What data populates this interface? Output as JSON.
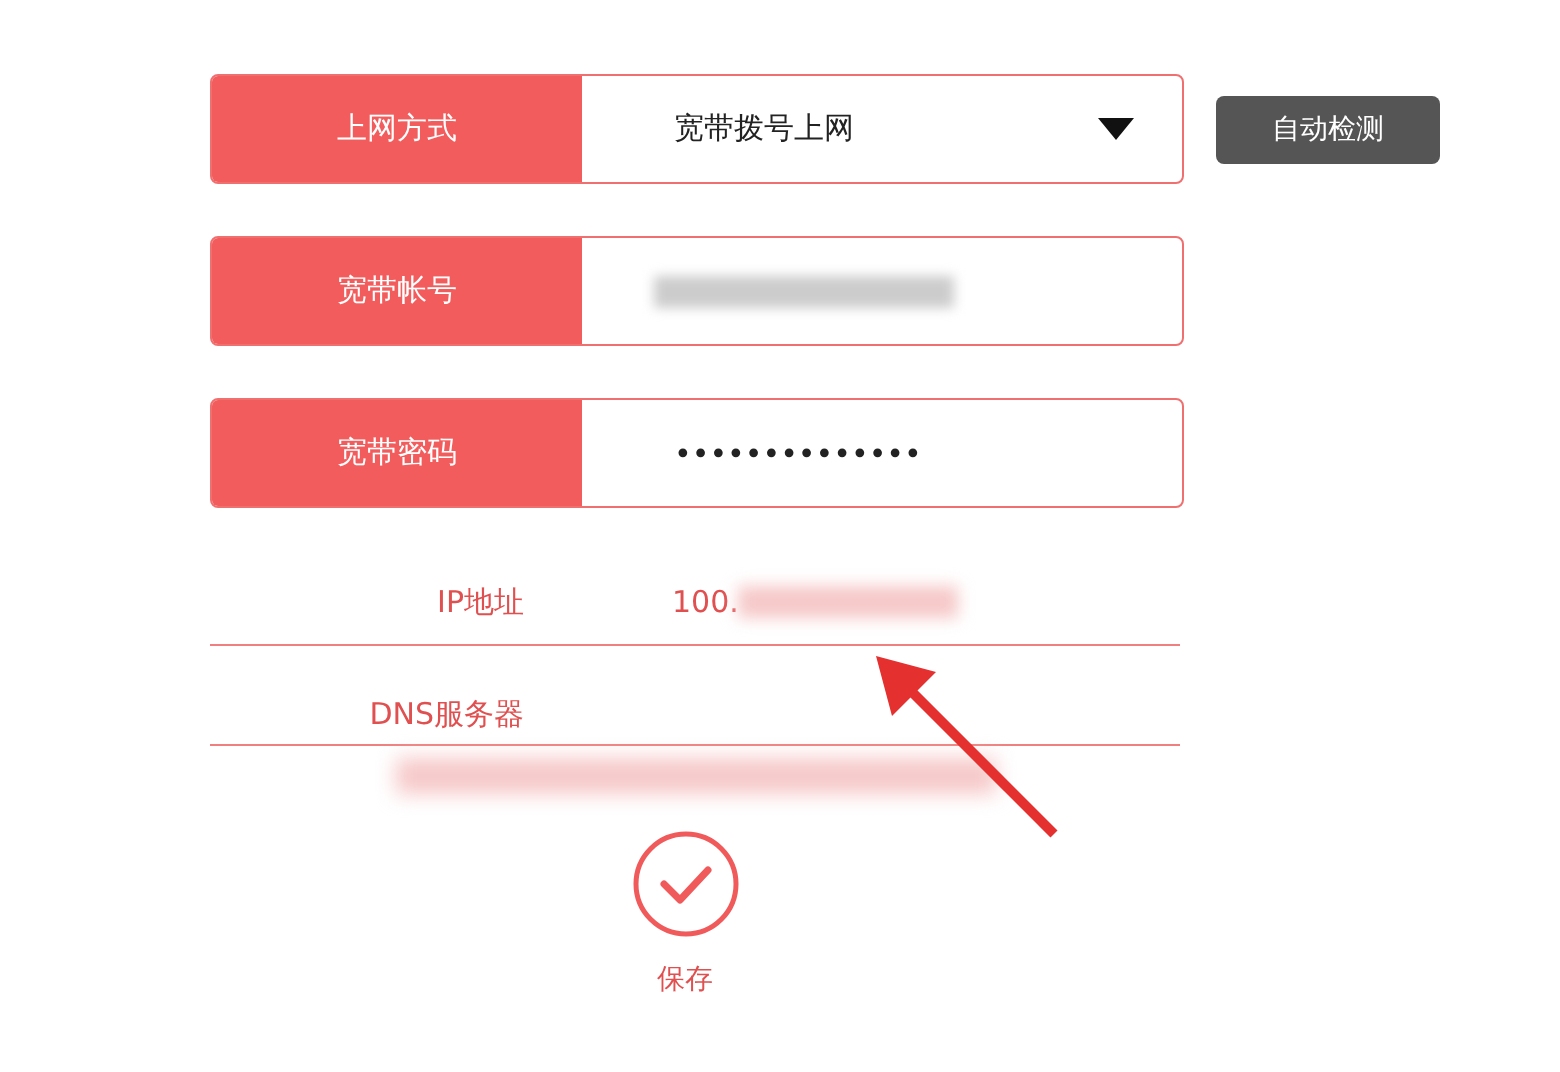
{
  "fields": [
    {
      "kind": "select",
      "label": "上网方式",
      "value": "宽带拨号上网",
      "button": "自动检测"
    },
    {
      "kind": "text",
      "label": "宽带帐号",
      "redacted": true
    },
    {
      "kind": "password",
      "label": "宽带密码",
      "value": "••••••••••••••"
    }
  ],
  "info_rows": [
    {
      "label": "IP地址",
      "value": "100.",
      "redacted": true
    },
    {
      "label": "DNS服务器",
      "redacted": true
    }
  ],
  "save": {
    "label": "保存"
  }
}
